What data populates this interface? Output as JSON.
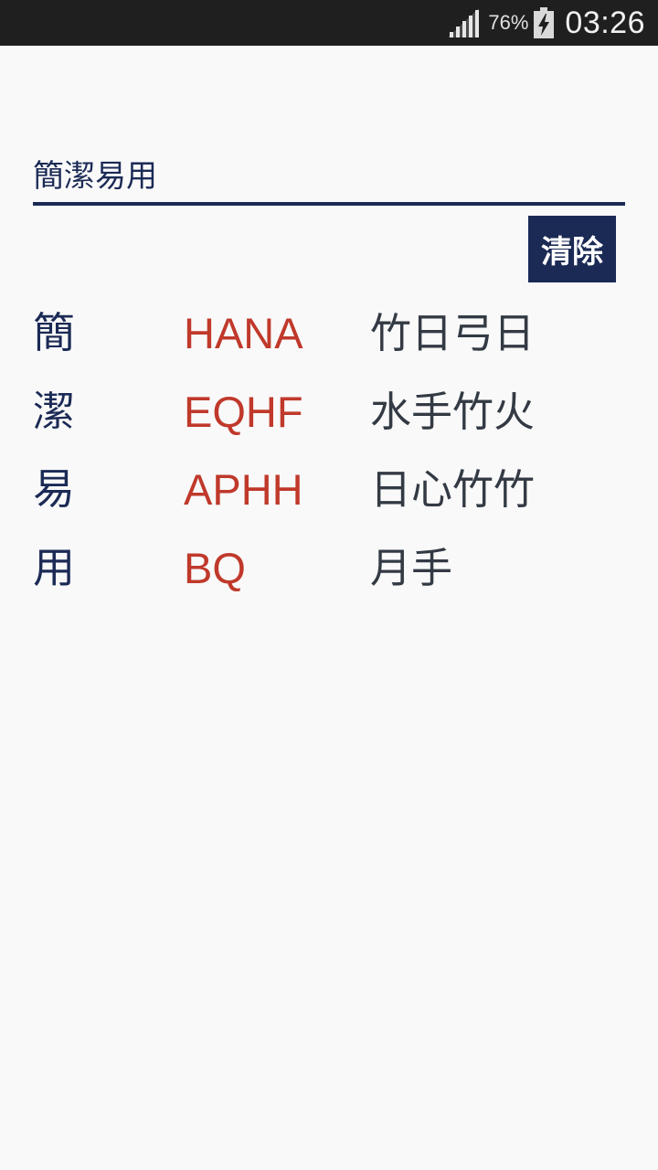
{
  "status_bar": {
    "battery_percent": "76%",
    "time": "03:26",
    "icons": [
      "signal-icon",
      "battery-charging-icon"
    ]
  },
  "input": {
    "value": "簡潔易用",
    "placeholder": ""
  },
  "clear_button": {
    "label": "清除"
  },
  "results": [
    {
      "char": "簡",
      "code": "HANA",
      "radicals": "竹日弓日"
    },
    {
      "char": "潔",
      "code": "EQHF",
      "radicals": "水手竹火"
    },
    {
      "char": "易",
      "code": "APHH",
      "radicals": "日心竹竹"
    },
    {
      "char": "用",
      "code": "BQ",
      "radicals": "月手"
    }
  ],
  "colors": {
    "primary": "#1b2a55",
    "code": "#c0392b",
    "radicals": "#333a44",
    "background": "#f9f9f9",
    "status_bar": "#1f1f1f"
  }
}
